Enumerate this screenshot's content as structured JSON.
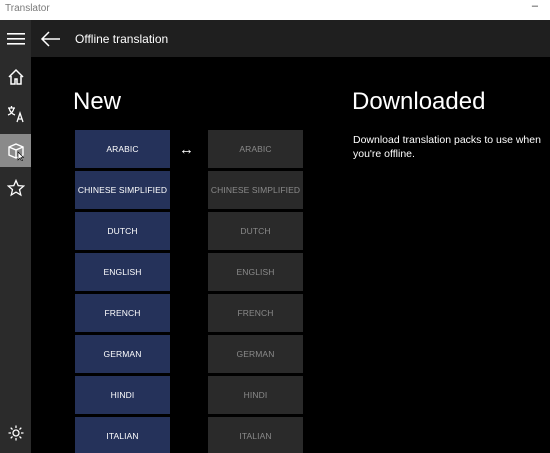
{
  "window": {
    "title": "Translator",
    "minimize_glyph": "–"
  },
  "header": {
    "title": "Offline translation"
  },
  "sidebar": {
    "items": [
      {
        "icon": "hamburger-icon"
      },
      {
        "icon": "home-icon"
      },
      {
        "icon": "translate-icon"
      },
      {
        "icon": "offline-packs-icon",
        "active": true
      },
      {
        "icon": "star-icon"
      },
      {
        "icon": "gear-icon"
      }
    ]
  },
  "new_section": {
    "title": "New",
    "languages": [
      "ARABIC",
      "CHINESE SIMPLIFIED",
      "DUTCH",
      "ENGLISH",
      "FRENCH",
      "GERMAN",
      "HINDI",
      "ITALIAN"
    ]
  },
  "downloaded_section": {
    "title": "Downloaded",
    "description": "Download translation packs to use when you're offline.",
    "languages": [
      "ARABIC",
      "CHINESE SIMPLIFIED",
      "DUTCH",
      "ENGLISH",
      "FRENCH",
      "GERMAN",
      "HINDI",
      "ITALIAN"
    ]
  },
  "swap_glyph": "↔",
  "colors": {
    "new_button": "#25325a",
    "downloaded_button": "#2a2a2a",
    "sidebar": "#2b2b2b",
    "active_sidebar": "#8a8a8a"
  }
}
